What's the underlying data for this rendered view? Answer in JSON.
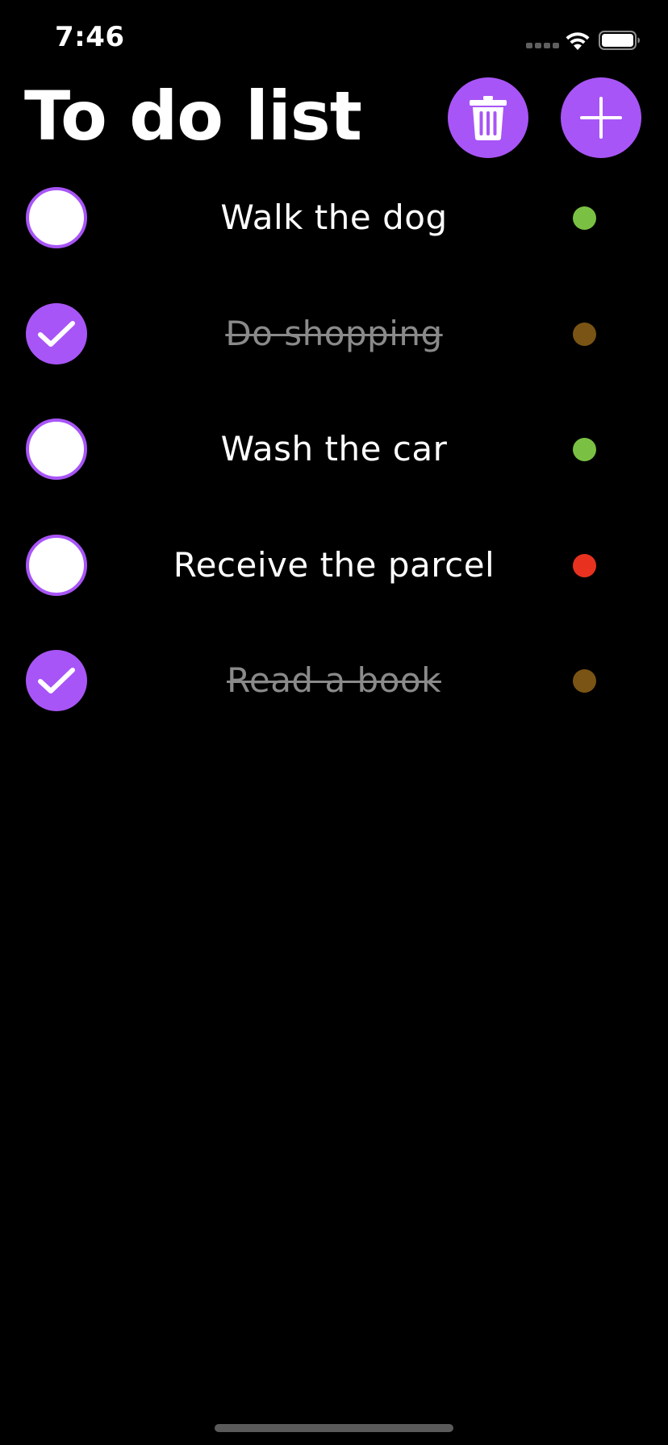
{
  "status_bar": {
    "time": "7:46"
  },
  "header": {
    "title": "To do list",
    "delete_icon": "trash-icon",
    "add_icon": "plus-icon"
  },
  "colors": {
    "accent": "#a855f7",
    "background": "#000000",
    "priority_low": "#7ac143",
    "priority_medium": "#7a5414",
    "priority_high": "#e8321f",
    "done_text": "#8a8a8a"
  },
  "todos": [
    {
      "label": "Walk the dog",
      "done": false,
      "priority": "low"
    },
    {
      "label": "Do shopping",
      "done": true,
      "priority": "medium"
    },
    {
      "label": "Wash the car",
      "done": false,
      "priority": "low"
    },
    {
      "label": "Receive the parcel",
      "done": false,
      "priority": "high"
    },
    {
      "label": "Read a book",
      "done": true,
      "priority": "medium"
    }
  ]
}
